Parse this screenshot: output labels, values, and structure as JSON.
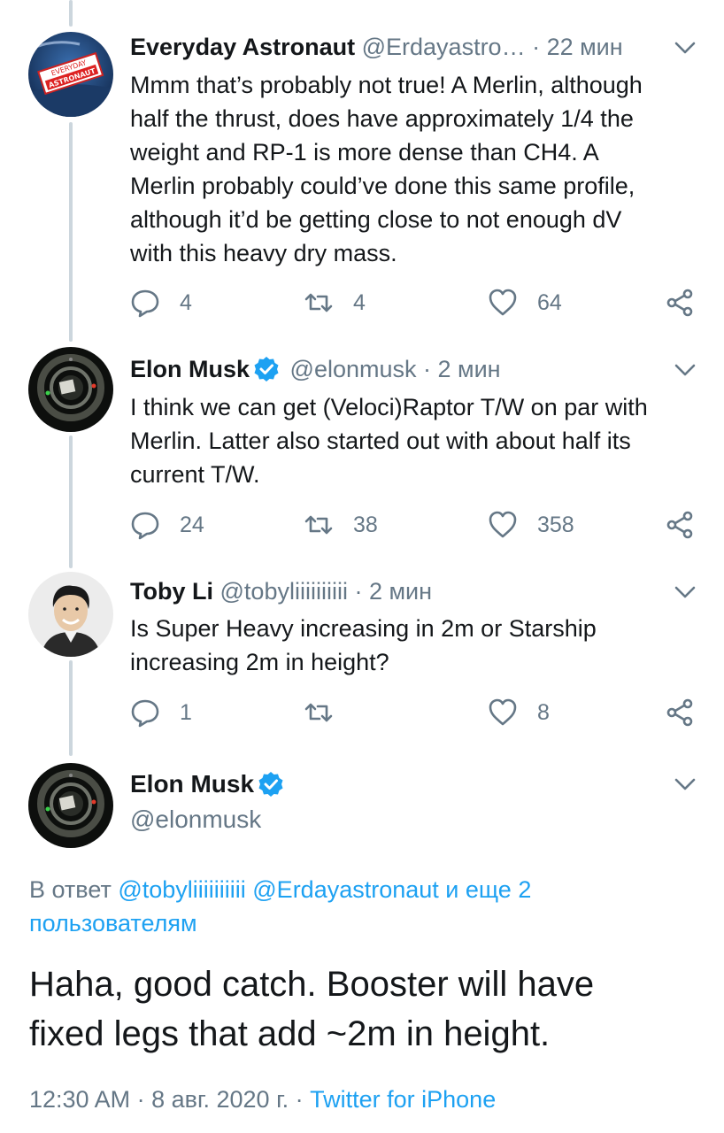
{
  "tweets": [
    {
      "name": "Everyday Astronaut",
      "handle": "@Erdayastro…",
      "time": "· 22 мин",
      "verified": false,
      "lines": [
        "Mmm that’s probably not true! A Merlin, although",
        "half the thrust, does have approximately 1/4 the",
        "weight and RP-1 is more dense than CH4. A",
        "Merlin probably could’ve done this same profile,",
        "although it’d be getting close to not enough dV",
        "with this heavy dry mass."
      ],
      "replies": "4",
      "retweets": "4",
      "likes": "64"
    },
    {
      "name": "Elon Musk",
      "handle": "@elonmusk",
      "time": "· 2 мин",
      "verified": true,
      "lines": [
        "I think we can get (Veloci)Raptor T/W on par with",
        "Merlin. Latter also started out with about half its",
        "current T/W."
      ],
      "replies": "24",
      "retweets": "38",
      "likes": "358"
    },
    {
      "name": "Toby Li",
      "handle": "@tobyliiiiiiiiii",
      "time": "· 2 мин",
      "verified": false,
      "lines": [
        "Is Super Heavy increasing in 2m or Starship",
        "increasing 2m in height?"
      ],
      "replies": "1",
      "retweets": "",
      "likes": "8"
    }
  ],
  "main": {
    "name": "Elon Musk",
    "handle": "@elonmusk",
    "reply_prefix": "В ответ",
    "reply_users": "@tobyliiiiiiiiii @Erdayastronaut и еще 2",
    "reply_users_line2": "пользователям",
    "text_lines": [
      "Haha, good catch. Booster will have",
      "fixed legs that add ~2m in height."
    ],
    "time": "12:30 AM · 8 авг. 2020 г.",
    "separator": " · ",
    "client": "Twitter for iPhone"
  },
  "icons": {
    "reply": "reply-icon",
    "retweet": "retweet-icon",
    "like": "like-icon",
    "share": "share-icon",
    "chevron": "chevron-down-icon",
    "verified": "verified-badge-icon"
  },
  "colors": {
    "accent": "#1da1f2",
    "secondary_text": "#657786",
    "primary_text": "#14171a",
    "thread_line": "#ccd6dd"
  }
}
